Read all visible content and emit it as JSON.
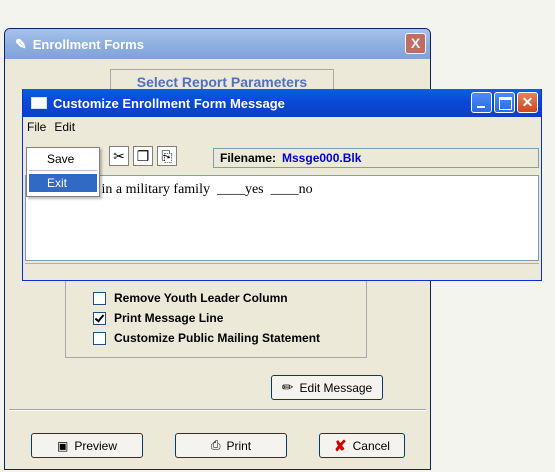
{
  "back_window": {
    "title": "Enrollment Forms",
    "close_label": "X",
    "section_title": "Select Report Parameters",
    "checkboxes": [
      {
        "label": "Remove Youth Leader Column",
        "checked": false
      },
      {
        "label": "Print Message Line",
        "checked": true
      },
      {
        "label": "Customize Public Mailing Statement",
        "checked": false
      }
    ],
    "edit_message_label": "Edit Message",
    "preview_label": "Preview",
    "print_label": "Print",
    "cancel_label": "Cancel",
    "colors": {
      "cancel_icon": "#cc0000",
      "section_title": "#5070c0"
    }
  },
  "front_window": {
    "title": "Customize Enrollment Form Message",
    "menu": [
      "File",
      "Edit"
    ],
    "filename_label": "Filename:",
    "filename_value": "Mssge000.Blk",
    "editor_text": "is your child in a military family  ____yes  ____no",
    "colors": {
      "titlebar": "#0a4ad6",
      "filename_value": "#0000cc"
    }
  },
  "file_menu": {
    "items": [
      "Save",
      "Exit"
    ],
    "highlighted": "Exit"
  }
}
